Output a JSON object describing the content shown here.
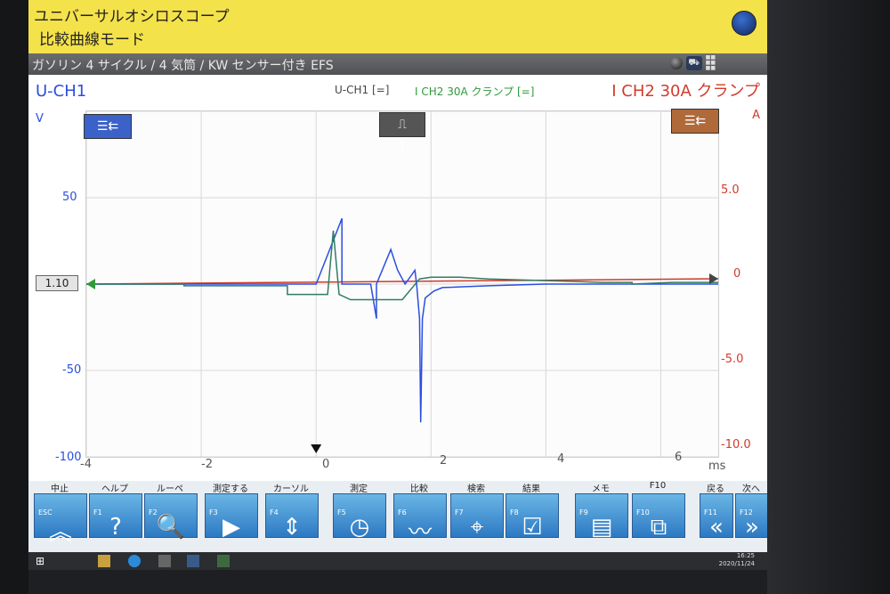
{
  "title": {
    "app": "ユニバーサルオシロスコープ",
    "mode": "比較曲線モード"
  },
  "vehicle": "ガソリン 4 サイクル /  4 気筒 / KW センサー付き EFS",
  "header": {
    "ch1": "U-CH1",
    "ch1_info": "U-CH1 [=]",
    "ch2_info": "I CH2 30A クランプ [=]",
    "ch2": "I CH2 30A クランプ",
    "unit_left": "V",
    "unit_right": "A",
    "trigger_channel": "1"
  },
  "axes": {
    "y_left_ticks": [
      "50",
      "-50",
      "-100"
    ],
    "y_right_ticks": [
      "5.0",
      "0",
      "-5.0",
      "-10.0"
    ],
    "x_ticks": [
      "-4",
      "-2",
      "0",
      "2",
      "4",
      "6"
    ],
    "x_unit": "ms",
    "offset": "1.10"
  },
  "chart_data": {
    "type": "line",
    "xlabel": "ms",
    "ylabel": "V",
    "xlim": [
      -4,
      7
    ],
    "ylim": [
      -100,
      100
    ],
    "series": [
      {
        "name": "U-CH1",
        "color": "#2b4ee0",
        "x": [
          -4,
          0,
          0.45,
          0.45,
          0.95,
          1.05,
          1.05,
          1.3,
          1.42,
          1.55,
          1.72,
          1.75,
          1.8,
          1.82,
          1.85,
          1.9,
          2.05,
          2.2,
          3.0,
          4.0,
          5.0,
          6.0,
          7.0
        ],
        "y": [
          0,
          0,
          38,
          0,
          0,
          -20,
          0,
          20,
          8,
          0,
          8,
          0,
          -20,
          -80,
          -20,
          -8,
          -4,
          -2,
          -1,
          0,
          0,
          0,
          0
        ]
      },
      {
        "name": "I CH2 30A クランプ",
        "color": "#2f7d66",
        "x": [
          -4,
          -2.3,
          -2.3,
          -0.5,
          -0.5,
          0.2,
          0.3,
          0.4,
          0.6,
          1.0,
          1.5,
          1.8,
          2.0,
          2.5,
          3.0,
          4.0,
          5.0,
          5.5,
          5.5,
          6.2,
          7.0
        ],
        "y": [
          0,
          0,
          -0.1,
          -0.1,
          -0.6,
          -0.6,
          3.1,
          -0.6,
          -0.9,
          -0.9,
          -0.9,
          0.3,
          0.4,
          0.4,
          0.3,
          0.2,
          0.1,
          0.1,
          0.0,
          0.1,
          0.1
        ]
      }
    ]
  },
  "fkeys": [
    {
      "label": "中止",
      "fn": "ESC",
      "icon": "chevron-up-icon",
      "glyph": "︽"
    },
    {
      "label": "ヘルプ",
      "fn": "F1",
      "icon": "question-icon",
      "glyph": "?"
    },
    {
      "label": "ルーペ",
      "fn": "F2",
      "icon": "magnifier-icon",
      "glyph": "🔍"
    },
    {
      "label": "測定する",
      "fn": "F3",
      "icon": "play-icon",
      "glyph": "▶"
    },
    {
      "label": "カーソル",
      "fn": "F4",
      "icon": "cursor-wave-icon",
      "glyph": "⇕"
    },
    {
      "label": "測定",
      "fn": "F5",
      "icon": "measure-icon",
      "glyph": "◷"
    },
    {
      "label": "比較",
      "fn": "F6",
      "icon": "compare-icon",
      "glyph": "〰"
    },
    {
      "label": "検索",
      "fn": "F7",
      "icon": "binoculars-icon",
      "glyph": "⌖"
    },
    {
      "label": "結果",
      "fn": "F8",
      "icon": "result-icon",
      "glyph": "☑"
    },
    {
      "label": "メモ",
      "fn": "F9",
      "icon": "document-icon",
      "glyph": "▤"
    },
    {
      "label": "F10",
      "fn": "F10",
      "icon": "layout-icon",
      "glyph": "⧉"
    },
    {
      "label": "戻る",
      "fn": "F11",
      "icon": "back-icon",
      "glyph": "«"
    },
    {
      "label": "次へ",
      "fn": "F12",
      "icon": "next-icon",
      "glyph": "»"
    }
  ],
  "clock": {
    "time": "16:25",
    "date": "2020/11/24"
  }
}
